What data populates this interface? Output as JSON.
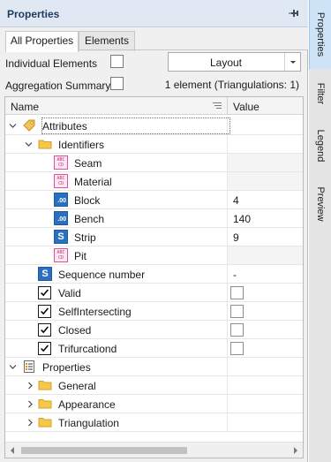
{
  "panel": {
    "title": "Properties"
  },
  "tabs": [
    "All Properties",
    "Elements"
  ],
  "options": {
    "individual_label": "Individual Elements",
    "aggregation_label": "Aggregation Summary",
    "layout_value": "Layout",
    "summary_text": "1 element (Triangulations: 1)"
  },
  "grid": {
    "col_name": "Name",
    "col_value": "Value",
    "rows": [
      {
        "label": "Attributes"
      },
      {
        "label": "Identifiers"
      },
      {
        "label": "Seam",
        "value": ""
      },
      {
        "label": "Material",
        "value": ""
      },
      {
        "label": "Block",
        "value": "4"
      },
      {
        "label": "Bench",
        "value": "140"
      },
      {
        "label": "Strip",
        "value": "9"
      },
      {
        "label": "Pit",
        "value": ""
      },
      {
        "label": "Sequence number",
        "value": "-"
      },
      {
        "label": "Valid"
      },
      {
        "label": "SelfIntersecting"
      },
      {
        "label": "Closed"
      },
      {
        "label": "Trifurcationd"
      },
      {
        "label": "Properties"
      },
      {
        "label": "General"
      },
      {
        "label": "Appearance"
      },
      {
        "label": "Triangulation"
      }
    ]
  },
  "side_tabs": [
    "Properties",
    "Filter",
    "Legend",
    "Preview"
  ],
  "colors": {
    "title_bar": "#dfe8f3",
    "active_side_tab": "#cfe3f6",
    "folder": "#f5c84c",
    "abc_icon": "#d9559a",
    "number_icon": "#2a6fc1"
  }
}
